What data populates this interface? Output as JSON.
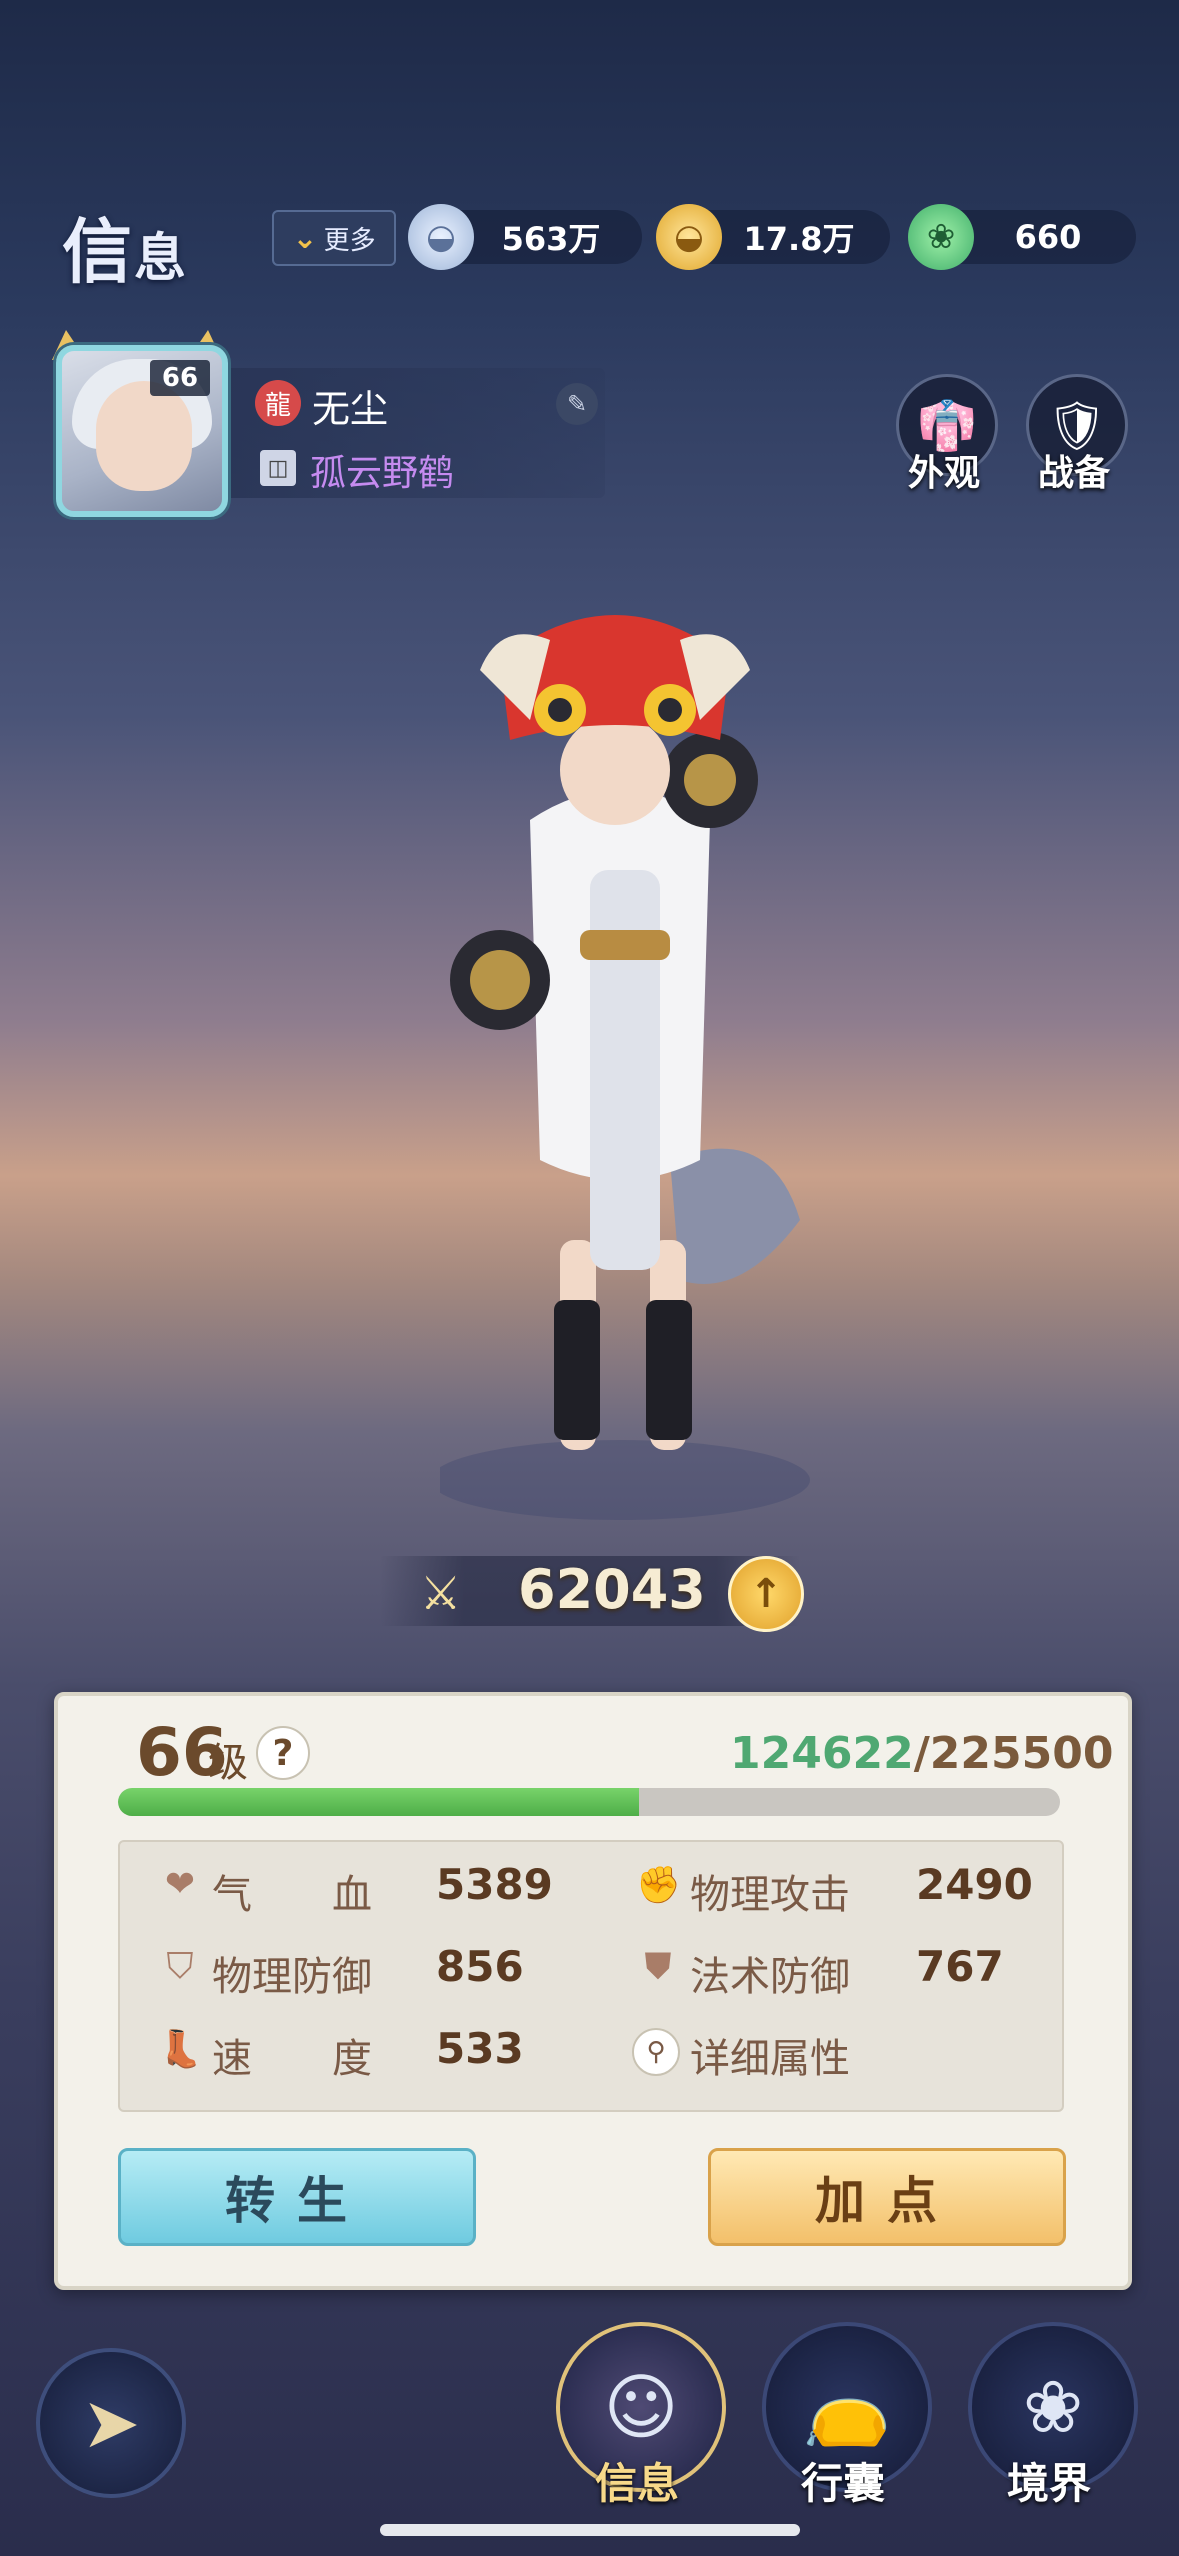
{
  "header": {
    "title_big": "信",
    "title_small": "息",
    "more_label": "更多",
    "currencies": [
      {
        "icon": "silver-ingot-icon",
        "value": "563万"
      },
      {
        "icon": "gold-ingot-icon",
        "value": "17.8万"
      },
      {
        "icon": "jade-icon",
        "value": "660"
      }
    ]
  },
  "player": {
    "level_badge": "66",
    "name": "无尘",
    "title": "孤云野鹤"
  },
  "side_buttons": [
    {
      "label": "外观",
      "icon": "outfit-icon"
    },
    {
      "label": "战备",
      "icon": "equipment-icon"
    }
  ],
  "power": {
    "value": "62043"
  },
  "panel": {
    "level": "66",
    "level_suffix": "级",
    "exp_current": "124622",
    "exp_max": "/225500",
    "exp_fraction": 0.553,
    "stats": [
      {
        "icon": "heart-icon",
        "label": "气　　血",
        "value": "5389"
      },
      {
        "icon": "fist-icon",
        "label": "物理攻击",
        "value": "2490"
      },
      {
        "icon": "shield-icon",
        "label": "物理防御",
        "value": "856"
      },
      {
        "icon": "magic-shield-icon",
        "label": "法术防御",
        "value": "767"
      },
      {
        "icon": "boot-icon",
        "label": "速　　度",
        "value": "533"
      }
    ],
    "detail_label": "详细属性",
    "rebirth_label": "转生",
    "add_points_label": "加点"
  },
  "nav": [
    {
      "label": "信息",
      "icon": "info-icon",
      "active": true
    },
    {
      "label": "行囊",
      "icon": "bag-icon",
      "active": false
    },
    {
      "label": "境界",
      "icon": "lotus-icon",
      "active": false
    }
  ],
  "colors": {
    "exp_green": "#4fa872",
    "title_purple": "#c58bf0",
    "gold": "#f3c06a",
    "blue": "#6fcbe0"
  }
}
